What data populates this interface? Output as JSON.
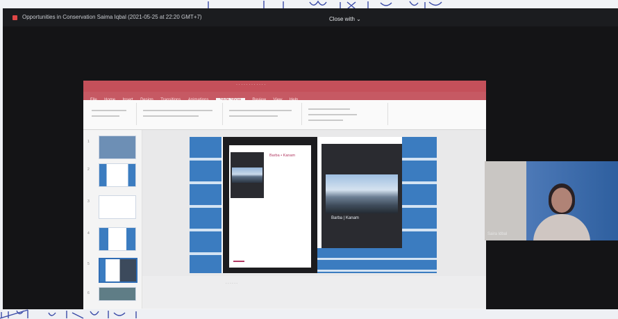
{
  "handwriting": {
    "top": "top-edge notebook handwriting (partial strokes)",
    "bottom": "bottom-edge notebook handwriting (partial strokes)"
  },
  "zoom": {
    "meeting_title": "Opportunities in Conservation",
    "host_and_time": "Saima Iqbal (2021-05-25 at 22:20 GMT+7)",
    "view_button": "Close with ⌄"
  },
  "powerpoint": {
    "tabs": [
      "File",
      "Home",
      "Insert",
      "Design",
      "Transitions",
      "Animations",
      "Slide Show",
      "Review",
      "View",
      "Help"
    ],
    "active_tab": "Slide Show",
    "slide_numbers": [
      "1",
      "2",
      "3",
      "4",
      "5",
      "6"
    ],
    "selected_slide": 5,
    "slide": {
      "book_title": "Barba • Kanam",
      "cover_title": "Barba | Kanam"
    }
  },
  "participant": {
    "name": "Saira ldbal"
  },
  "colors": {
    "ppt_accent": "#c4505a",
    "slide_blue": "#3b7cc0",
    "zoom_bg": "#141416"
  }
}
